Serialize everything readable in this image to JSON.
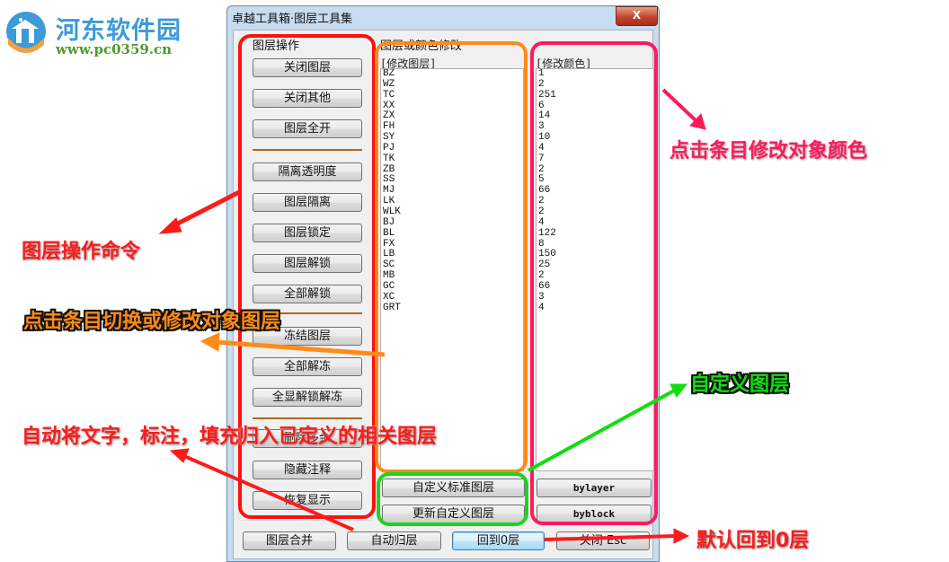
{
  "watermark": {
    "title": "河东软件园",
    "url": "www.pc0359.cn"
  },
  "window": {
    "title": "卓越工具箱·图层工具集",
    "close_label": "X"
  },
  "layer_ops": {
    "group_label": "图层操作",
    "buttons": [
      "关闭图层",
      "关闭其他",
      "图层全开",
      "隔离透明度",
      "图层隔离",
      "图层锁定",
      "图层解锁",
      "全部解锁",
      "冻结图层",
      "全部解冻",
      "全显解锁解冻",
      "删除多余",
      "隐藏注释",
      "恢复显示"
    ]
  },
  "modify": {
    "group_label": "图层或颜色修改",
    "layer_header": "[修改图层]",
    "color_header": "[修改颜色]",
    "layers": [
      "BZ",
      "WZ",
      "TC",
      "XX",
      "ZX",
      "FH",
      "SY",
      "PJ",
      "TK",
      "ZB",
      "SS",
      "MJ",
      "LK",
      "WLK",
      "BJ",
      "BL",
      "FX",
      "LB",
      "SC",
      "MB",
      "GC",
      "XC",
      "GRT"
    ],
    "colors": [
      "1",
      "2",
      "251",
      "6",
      "14",
      "3",
      "10",
      "4",
      "7",
      "2",
      "5",
      "66",
      "2",
      "2",
      "4",
      "122",
      "8",
      "150",
      "25",
      "2",
      "66",
      "3",
      "4"
    ],
    "custom_std_button": "自定义标准图层",
    "update_custom_button": "更新自定义图层",
    "bylayer_button": "bylayer",
    "byblock_button": "byblock"
  },
  "bottom": {
    "merge_button": "图层合并",
    "auto_layer_button": "自动归层",
    "back_to_zero_button": "回到0层",
    "close_button": "关闭 Esc"
  },
  "annotations": {
    "layer_ops": "图层操作命令",
    "click_layer": "点击条目切换或修改对象图层",
    "click_color": "点击条目修改对象颜色",
    "custom_layer": "自定义图层",
    "auto_assign": "自动将文字，标注，填充归入已定义的相关图层",
    "default_zero": "默认回到0层"
  },
  "colors": {
    "red": "#ff1010",
    "orange": "#ff8a1a",
    "pink": "#ff1a60",
    "green": "#1fd21f"
  }
}
